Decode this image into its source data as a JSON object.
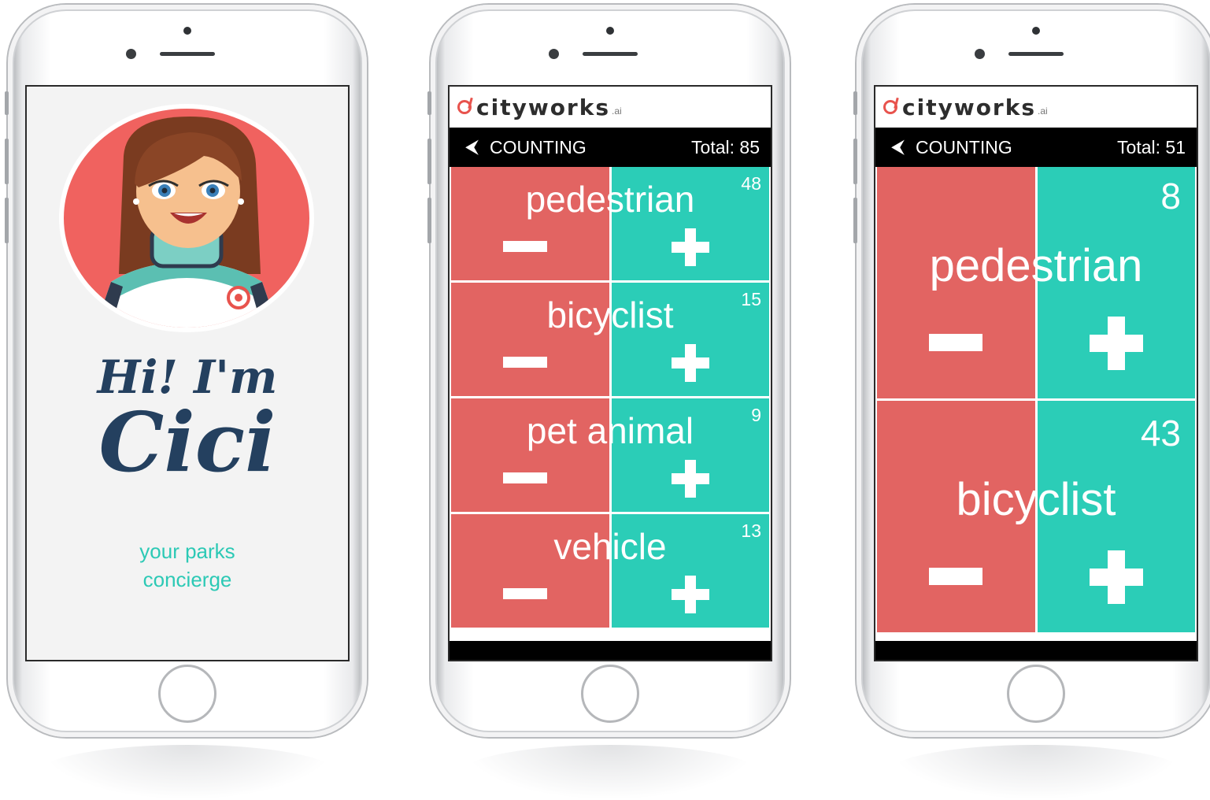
{
  "welcome": {
    "greeting_line1": "Hi! I'm",
    "greeting_line2": "Cici",
    "tagline_line1": "your parks",
    "tagline_line2": "concierge"
  },
  "app_header": {
    "logo_text": "cityworks",
    "logo_suffix": ".ai"
  },
  "phone2": {
    "title": "COUNTING",
    "total": "Total: 85",
    "items": [
      {
        "label": "pedestrian",
        "count": "48"
      },
      {
        "label": "bicyclist",
        "count": "15"
      },
      {
        "label": "pet animal",
        "count": "9"
      },
      {
        "label": "vehicle",
        "count": "13"
      }
    ]
  },
  "phone3": {
    "title": "COUNTING",
    "total": "Total: 51",
    "items": [
      {
        "label": "pedestrian",
        "count": "8"
      },
      {
        "label": "bicyclist",
        "count": "43"
      }
    ]
  },
  "icons": {
    "back": "left-arrow-icon",
    "decrement": "minus-icon",
    "increment": "plus-icon"
  },
  "colors": {
    "minus_tile": "#e26462",
    "plus_tile": "#2bcdb7",
    "greeting": "#24405f",
    "tagline": "#2cc9b5",
    "avatar_bg": "#f0625f"
  }
}
